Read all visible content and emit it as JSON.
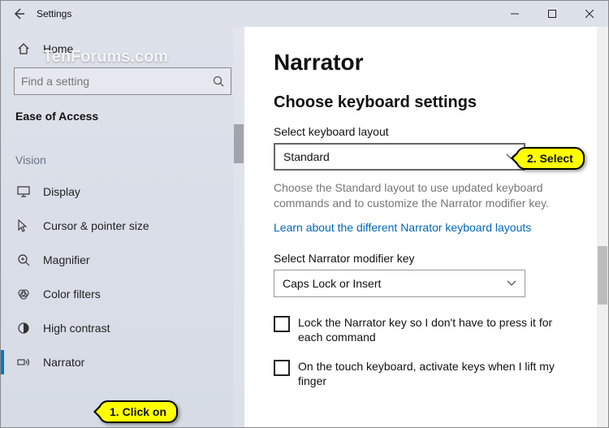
{
  "titlebar": {
    "title": "Settings"
  },
  "sidebar": {
    "home": "Home",
    "search_placeholder": "Find a setting",
    "section": "Ease of Access",
    "group": "Vision",
    "items": [
      {
        "label": "Display"
      },
      {
        "label": "Cursor & pointer size"
      },
      {
        "label": "Magnifier"
      },
      {
        "label": "Color filters"
      },
      {
        "label": "High contrast"
      },
      {
        "label": "Narrator"
      }
    ]
  },
  "watermark": "TenForums.com",
  "main": {
    "heading": "Narrator",
    "subheading": "Choose keyboard settings",
    "layout_label": "Select keyboard layout",
    "layout_value": "Standard",
    "layout_desc": "Choose the Standard layout to use updated keyboard commands and to customize the Narrator modifier key.",
    "learn_link": "Learn about the different Narrator keyboard layouts",
    "modifier_label": "Select Narrator modifier key",
    "modifier_value": "Caps Lock or Insert",
    "check_lock": "Lock the Narrator key so I don't have to press it for each command",
    "check_touch": "On the touch keyboard, activate keys when I lift my finger"
  },
  "annotations": {
    "click": "1. Click on",
    "select": "2. Select"
  }
}
